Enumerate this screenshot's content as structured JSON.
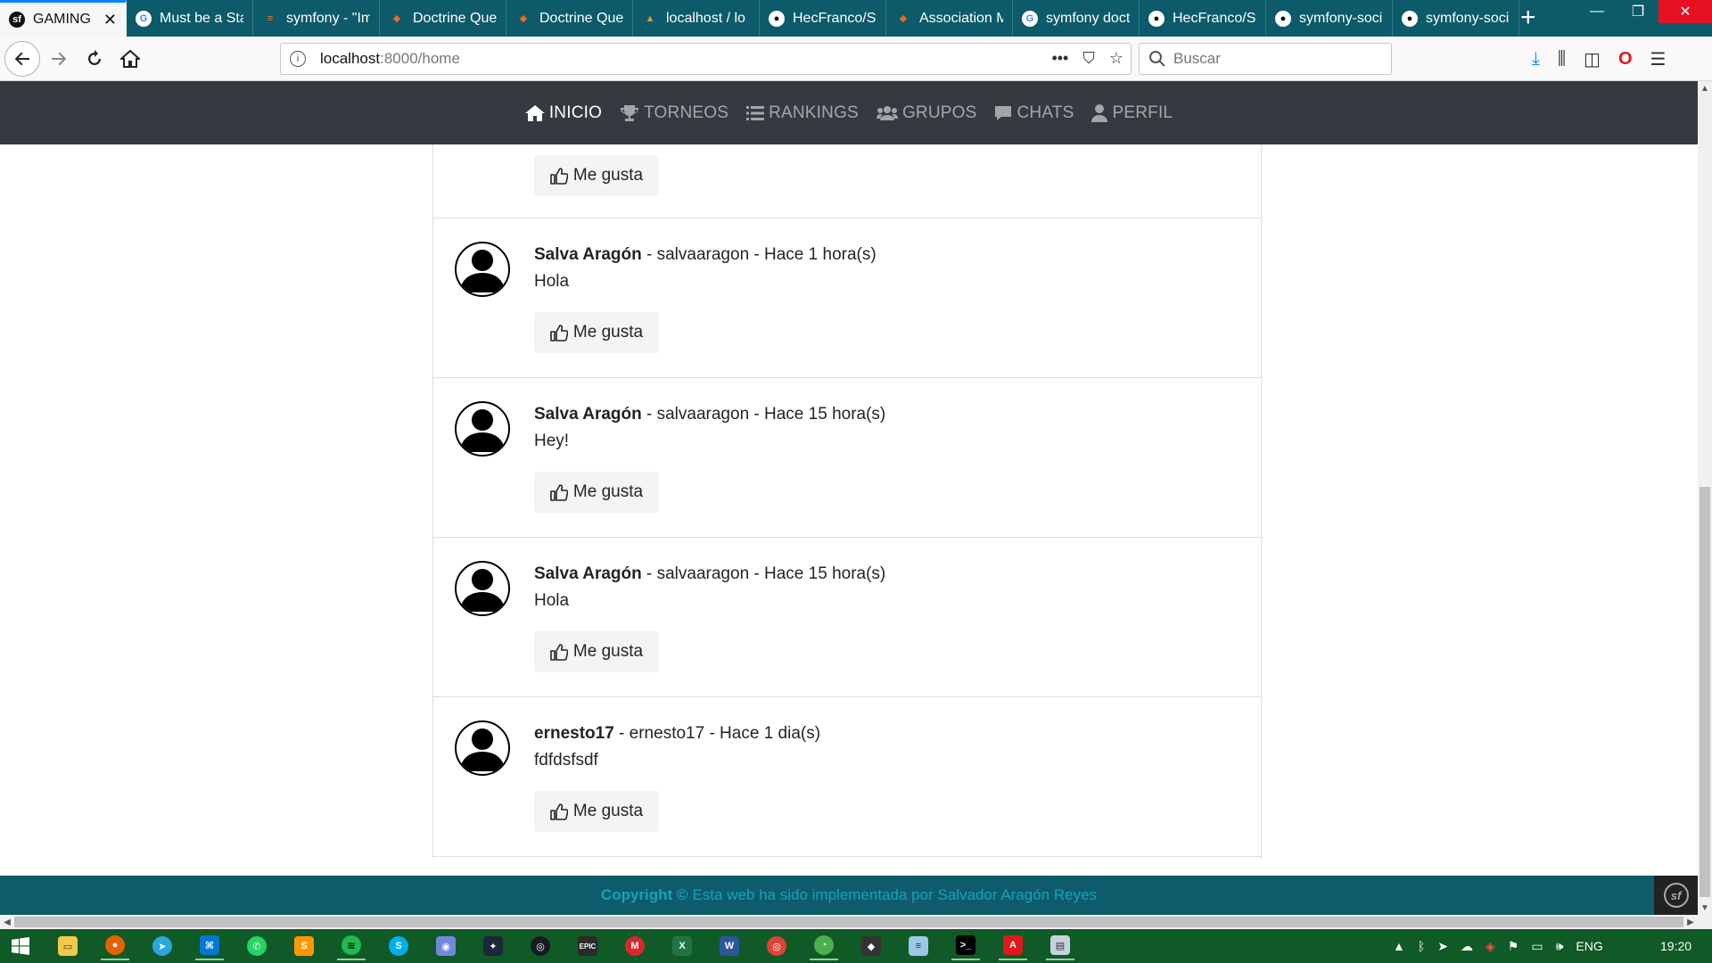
{
  "browser": {
    "tabs": [
      {
        "title": "GAMING",
        "favicon": "symfony-icon",
        "active": true
      },
      {
        "title": "Must be a Sta",
        "favicon": "google-icon"
      },
      {
        "title": "symfony - \"Im",
        "favicon": "stackoverflow-icon"
      },
      {
        "title": "Doctrine Que",
        "favicon": "doctrine-icon"
      },
      {
        "title": "Doctrine Que",
        "favicon": "doctrine-icon"
      },
      {
        "title": "localhost / lo",
        "favicon": "phpmyadmin-icon"
      },
      {
        "title": "HecFranco/Sy",
        "favicon": "github-icon"
      },
      {
        "title": "Association M",
        "favicon": "doctrine-icon"
      },
      {
        "title": "symfony doct",
        "favicon": "google-icon"
      },
      {
        "title": "HecFranco/Sy",
        "favicon": "github-icon"
      },
      {
        "title": "symfony-soci",
        "favicon": "github-icon"
      },
      {
        "title": "symfony-soci",
        "favicon": "github-icon"
      }
    ],
    "url_host": "localhost",
    "url_rest": ":8000/home",
    "search_placeholder": "Buscar",
    "theme_color": "#0c5a6a"
  },
  "site": {
    "nav": [
      {
        "label": "INICIO",
        "icon": "home-icon",
        "active": true
      },
      {
        "label": "TORNEOS",
        "icon": "trophy-icon"
      },
      {
        "label": "RANKINGS",
        "icon": "list-icon"
      },
      {
        "label": "GRUPOS",
        "icon": "users-icon"
      },
      {
        "label": "CHATS",
        "icon": "comment-icon"
      },
      {
        "label": "PERFIL",
        "icon": "user-icon"
      }
    ],
    "like_label": "Me gusta",
    "posts": [
      {
        "name": "Salva Aragón",
        "meta": " - salvaaragon - Hace 1 hora(s)",
        "body": "Hola"
      },
      {
        "name": "Salva Aragón",
        "meta": " - salvaaragon - Hace 15 hora(s)",
        "body": "Hey!"
      },
      {
        "name": "Salva Aragón",
        "meta": " - salvaaragon - Hace 15 hora(s)",
        "body": "Hola"
      },
      {
        "name": "ernesto17",
        "meta": " - ernesto17 - Hace 1 dia(s)",
        "body": "fdfdsfsdf"
      }
    ],
    "footer_strong": "Copyright ©",
    "footer_text": "Esta web ha sido implementada por Salvador Aragón Reyes",
    "navbar_color": "#343a40",
    "footer_color": "#0e5b6b"
  },
  "taskbar": {
    "tray_lang": "ENG",
    "clock": "19:20",
    "color": "#0f5a26"
  }
}
